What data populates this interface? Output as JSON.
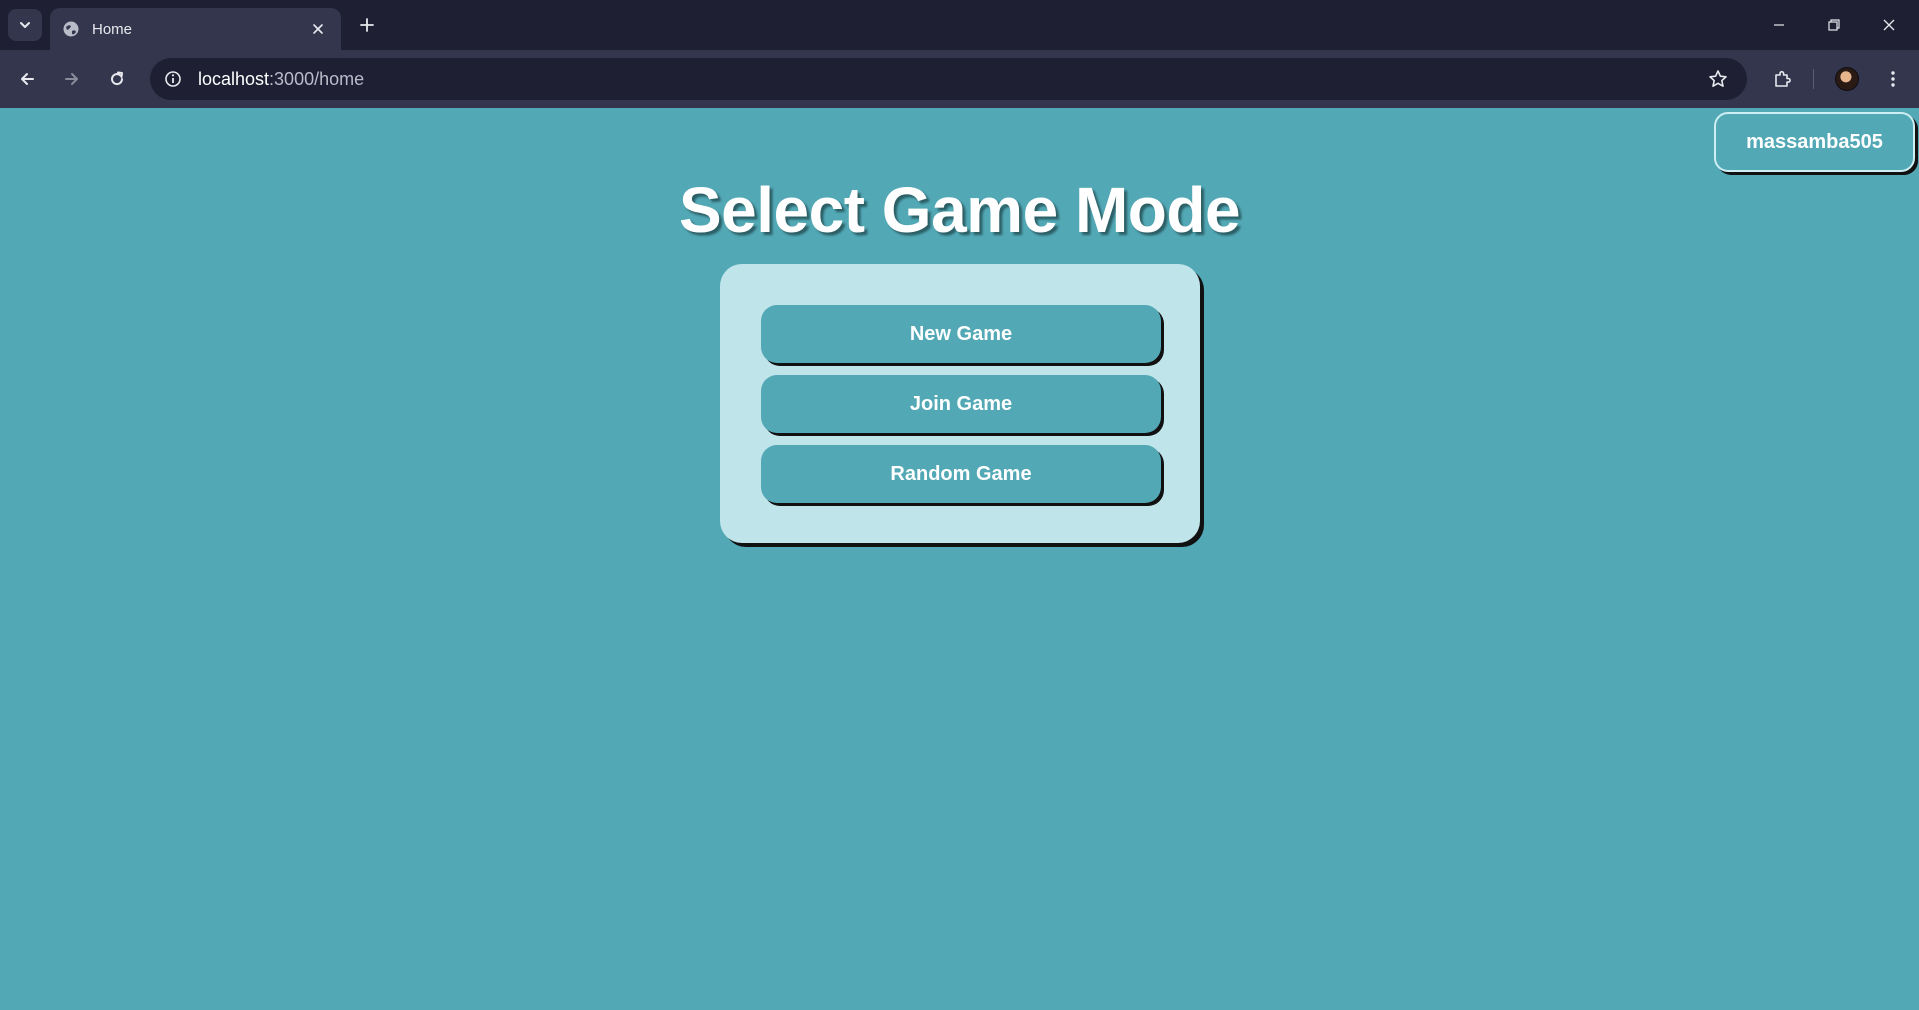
{
  "browser": {
    "tab": {
      "title": "Home"
    },
    "url": {
      "host": "localhost",
      "rest": ":3000/home"
    },
    "icons": {
      "tab_search": "chevron-down-icon",
      "favicon": "globe-icon",
      "tab_close": "close-icon",
      "new_tab": "plus-icon",
      "back": "arrow-left-icon",
      "forward": "arrow-right-icon",
      "reload": "reload-icon",
      "site_info": "info-icon",
      "bookmark": "star-icon",
      "extensions": "puzzle-icon",
      "profile": "avatar",
      "menu": "kebab-menu-icon",
      "minimize": "minimize-icon",
      "restore": "restore-icon",
      "close_window": "close-icon"
    }
  },
  "page": {
    "user_button": "massamba505",
    "title": "Select Game Mode",
    "modes": [
      {
        "label": "New Game"
      },
      {
        "label": "Join Game"
      },
      {
        "label": "Random Game"
      }
    ]
  },
  "colors": {
    "page_background": "#52a8b5",
    "panel_background": "#bfe4ea",
    "button_background": "#52a8b5",
    "text": "#ffffff",
    "chrome_dark": "#1e1f33",
    "chrome_toolbar": "#34364e"
  }
}
